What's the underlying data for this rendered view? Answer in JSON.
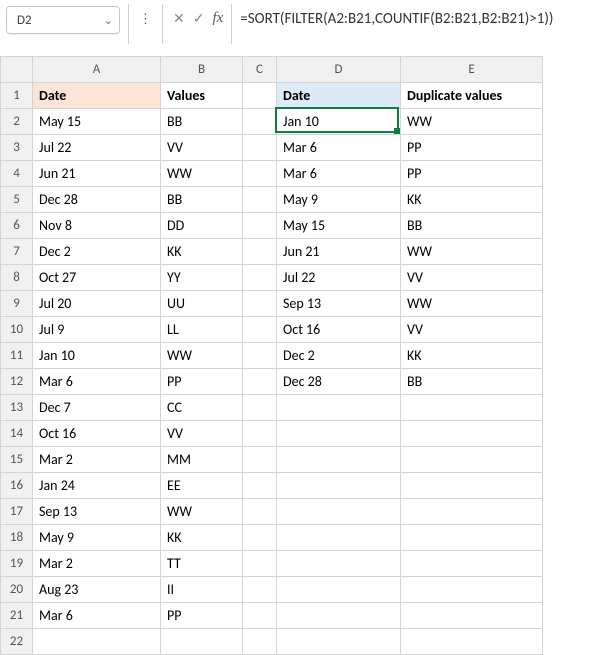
{
  "toolbar": {
    "cell_ref": "D2",
    "formula": "=SORT(FILTER(A2:B21,COUNTIF(B2:B21,B2:B21)>1))",
    "dropdown_glyph": "⌄",
    "dots_glyph": "⋮",
    "cancel_glyph": "✕",
    "accept_glyph": "✓",
    "fx_label": "fx"
  },
  "columns": [
    "A",
    "B",
    "C",
    "D",
    "E"
  ],
  "rows": [
    "1",
    "2",
    "3",
    "4",
    "5",
    "6",
    "7",
    "8",
    "9",
    "10",
    "11",
    "12",
    "13",
    "14",
    "15",
    "16",
    "17",
    "18",
    "19",
    "20",
    "21",
    "22"
  ],
  "headers": {
    "a1": "Date",
    "b1": "Values",
    "d1": "Date",
    "e1": "Duplicate values"
  },
  "left_table": [
    {
      "date": "May 15",
      "val": "BB"
    },
    {
      "date": "Jul 22",
      "val": "VV"
    },
    {
      "date": "Jun 21",
      "val": "WW"
    },
    {
      "date": "Dec 28",
      "val": "BB"
    },
    {
      "date": "Nov 8",
      "val": "DD"
    },
    {
      "date": "Dec 2",
      "val": "KK"
    },
    {
      "date": "Oct 27",
      "val": "YY"
    },
    {
      "date": "Jul 20",
      "val": "UU"
    },
    {
      "date": "Jul 9",
      "val": "LL"
    },
    {
      "date": "Jan 10",
      "val": "WW"
    },
    {
      "date": "Mar 6",
      "val": "PP"
    },
    {
      "date": "Dec 7",
      "val": "CC"
    },
    {
      "date": "Oct 16",
      "val": "VV"
    },
    {
      "date": "Mar 2",
      "val": "MM"
    },
    {
      "date": "Jan 24",
      "val": "EE"
    },
    {
      "date": "Sep 13",
      "val": "WW"
    },
    {
      "date": "May 9",
      "val": "KK"
    },
    {
      "date": "Mar 2",
      "val": "TT"
    },
    {
      "date": "Aug 23",
      "val": "II"
    },
    {
      "date": "Mar 6",
      "val": "PP"
    }
  ],
  "right_table": [
    {
      "date": "Jan 10",
      "val": "WW"
    },
    {
      "date": "Mar 6",
      "val": "PP"
    },
    {
      "date": "Mar 6",
      "val": "PP"
    },
    {
      "date": "May 9",
      "val": "KK"
    },
    {
      "date": "May 15",
      "val": "BB"
    },
    {
      "date": "Jun 21",
      "val": "WW"
    },
    {
      "date": "Jul 22",
      "val": "VV"
    },
    {
      "date": "Sep 13",
      "val": "WW"
    },
    {
      "date": "Oct 16",
      "val": "VV"
    },
    {
      "date": "Dec 2",
      "val": "KK"
    },
    {
      "date": "Dec 28",
      "val": "BB"
    }
  ]
}
